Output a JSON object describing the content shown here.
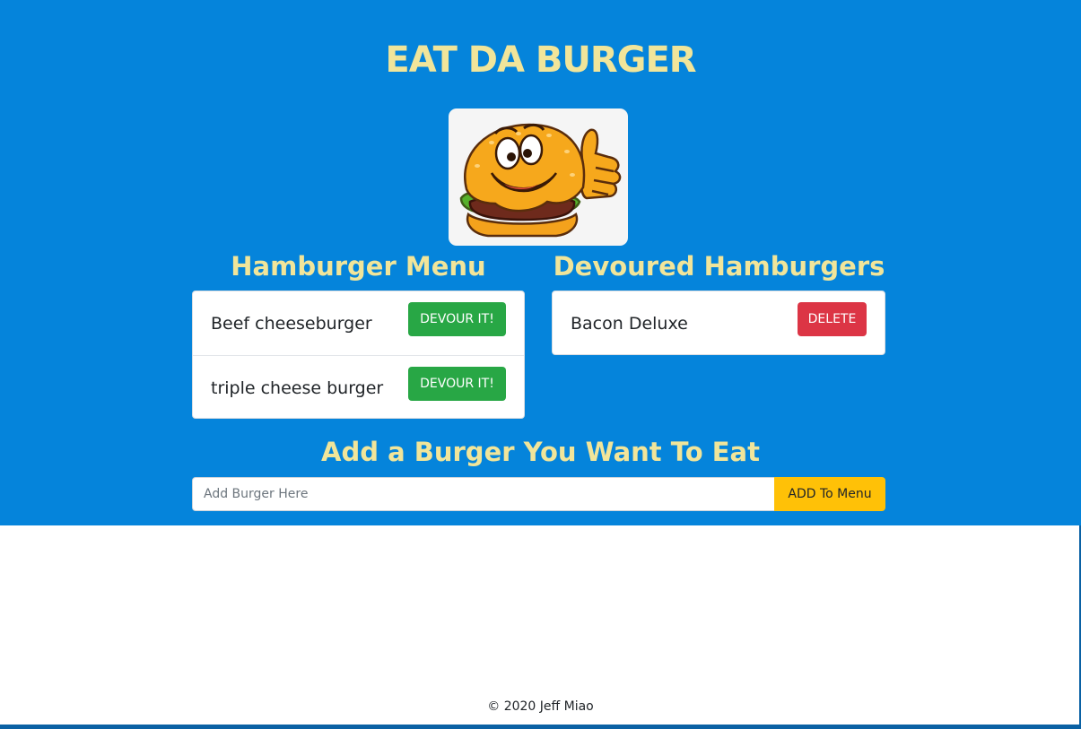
{
  "header": {
    "title": "EAT DA BURGER"
  },
  "logo": {
    "icon": "burger-mascot-thumbs-up-icon"
  },
  "menu": {
    "heading": "Hamburger Menu",
    "items": [
      {
        "name": "Beef cheeseburger",
        "action": "DEVOUR IT!"
      },
      {
        "name": "triple cheese burger",
        "action": "DEVOUR IT!"
      }
    ]
  },
  "devoured": {
    "heading": "Devoured Hamburgers",
    "items": [
      {
        "name": "Bacon Deluxe",
        "action": "DELETE"
      }
    ]
  },
  "add_form": {
    "heading": "Add a Burger You Want To Eat",
    "placeholder": "Add Burger Here",
    "value": "",
    "button_label": "ADD To Menu"
  },
  "footer": {
    "text": "© 2020 Jeff Miao"
  },
  "colors": {
    "hero_bg": "#0584db",
    "heading": "#f1e59a",
    "devour_button": "#28a745",
    "delete_button": "#dc3545",
    "add_button": "#ffc107"
  }
}
